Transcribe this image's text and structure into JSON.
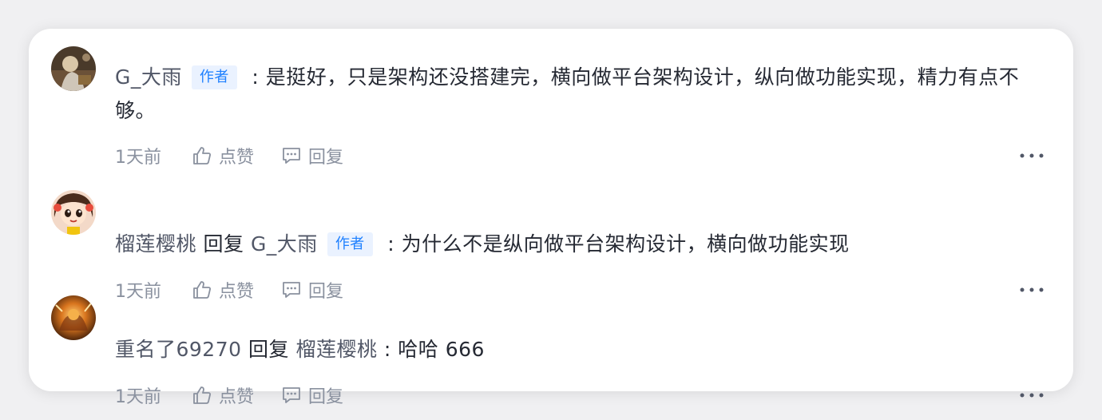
{
  "comments": [
    {
      "name": "G_大雨",
      "badge": "作者",
      "reply_word": "",
      "reply_to": "",
      "separator": " : ",
      "content": "是挺好，只是架构还没搭建完，横向做平台架构设计，纵向做功能实现，精力有点不够。",
      "time": "1天前",
      "like_label": "点赞",
      "reply_label": "回复",
      "avatar_icon": "avatar-figure-icon"
    },
    {
      "name": "榴莲樱桃",
      "badge": "作者",
      "reply_word": "回复",
      "reply_to": "G_大雨",
      "separator": " : ",
      "content": "为什么不是纵向做平台架构设计，横向做功能实现",
      "time": "1天前",
      "like_label": "点赞",
      "reply_label": "回复",
      "avatar_icon": "avatar-cartoon-girl-icon"
    },
    {
      "name": "重名了69270",
      "badge": "",
      "reply_word": "回复",
      "reply_to": "榴莲樱桃",
      "separator": " : ",
      "content": "哈哈 666",
      "time": "1天前",
      "like_label": "点赞",
      "reply_label": "回复",
      "avatar_icon": "avatar-fire-warrior-icon"
    }
  ],
  "colors": {
    "text": "#252933",
    "muted": "#8a919f",
    "badge_bg": "#eaf2ff",
    "badge_text": "#1e80ff"
  }
}
